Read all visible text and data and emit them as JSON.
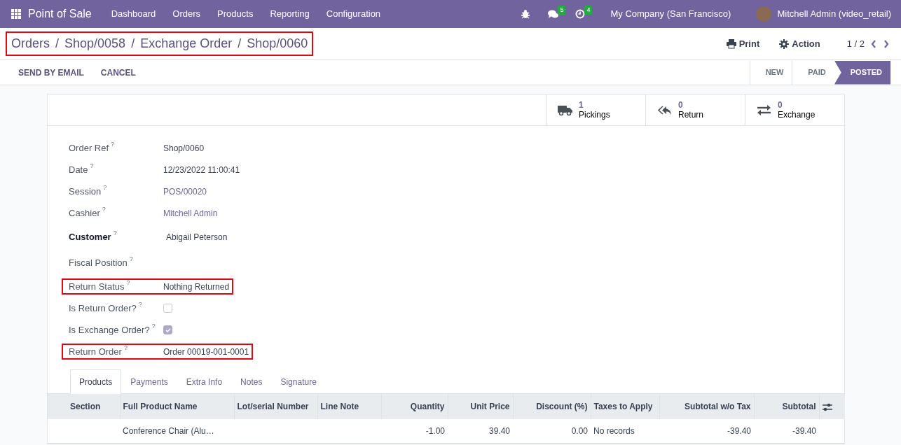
{
  "navbar": {
    "app_name": "Point of Sale",
    "menu": [
      "Dashboard",
      "Orders",
      "Products",
      "Reporting",
      "Configuration"
    ],
    "messages_count": "5",
    "activities_count": "4",
    "company": "My Company (San Francisco)",
    "user": "Mitchell Admin (video_retail)"
  },
  "breadcrumb": {
    "items": [
      "Orders",
      "Shop/0058",
      "Exchange Order",
      "Shop/0060"
    ],
    "separator": "/",
    "highlighted": true
  },
  "actions": [
    "Print",
    "Action"
  ],
  "pager": "1 / 2",
  "buttons": [
    "SEND BY EMAIL",
    "CANCEL"
  ],
  "statusbar": [
    {
      "label": "NEW",
      "selected": false
    },
    {
      "label": "PAID",
      "selected": false
    },
    {
      "label": "POSTED",
      "selected": true
    }
  ],
  "smart_buttons": [
    {
      "kind": "truck",
      "count": "1",
      "label": "Pickings"
    },
    {
      "kind": "return",
      "count": "0",
      "label": "Return"
    },
    {
      "kind": "exchange",
      "count": "0",
      "label": "Exchange"
    }
  ],
  "fields": [
    {
      "label": "Order Ref",
      "kind": "text",
      "value": "Shop/0060",
      "bold": false,
      "highlighted": false
    },
    {
      "label": "Date",
      "kind": "text",
      "value": "12/23/2022 11:00:41",
      "bold": false,
      "highlighted": false
    },
    {
      "label": "Session",
      "kind": "link",
      "value": "POS/00020",
      "bold": false,
      "highlighted": false
    },
    {
      "label": "Cashier",
      "kind": "link",
      "value": "Mitchell Admin",
      "bold": false,
      "highlighted": false
    },
    {
      "label": "Customer",
      "kind": "text",
      "value": "Abigail Peterson",
      "bold": true,
      "highlighted": false
    },
    {
      "label": "Fiscal Position",
      "kind": "empty",
      "bold": false,
      "highlighted": false
    },
    {
      "label": "Return Status",
      "kind": "text",
      "value": "Nothing Returned",
      "bold": false,
      "highlighted": true
    },
    {
      "label": "Is Return Order?",
      "kind": "checkbox",
      "checked": false,
      "bold": false,
      "highlighted": false
    },
    {
      "label": "Is Exchange Order?",
      "kind": "checkbox",
      "checked": true,
      "bold": false,
      "highlighted": false
    },
    {
      "label": "Return Order",
      "kind": "text",
      "value": "Order 00019-001-0001",
      "bold": false,
      "highlighted": true
    }
  ],
  "tabs": [
    {
      "label": "Products",
      "selected": true
    },
    {
      "label": "Payments",
      "selected": false
    },
    {
      "label": "Extra Info",
      "selected": false
    },
    {
      "label": "Notes",
      "selected": false
    },
    {
      "label": "Signature",
      "selected": false
    }
  ],
  "help_mark": "?",
  "table": {
    "columns": [
      {
        "label": "Section",
        "kind": "text"
      },
      {
        "label": "Full Product Name",
        "kind": "text"
      },
      {
        "label": "Lot/serial Number",
        "kind": "text"
      },
      {
        "label": "Line Note",
        "kind": "text"
      },
      {
        "label": "Quantity",
        "kind": "number"
      },
      {
        "label": "Unit Price",
        "kind": "number"
      },
      {
        "label": "Discount (%)",
        "kind": "number"
      },
      {
        "label": "Taxes to Apply",
        "kind": "text"
      },
      {
        "label": "Subtotal w/o Tax",
        "kind": "number"
      },
      {
        "label": "Subtotal",
        "kind": "number"
      }
    ],
    "rows": [
      [
        "",
        "Conference Chair (Alu…",
        "",
        "",
        "-1.00",
        "39.40",
        "0.00",
        "No records",
        "-39.40",
        "-39.40"
      ]
    ]
  }
}
